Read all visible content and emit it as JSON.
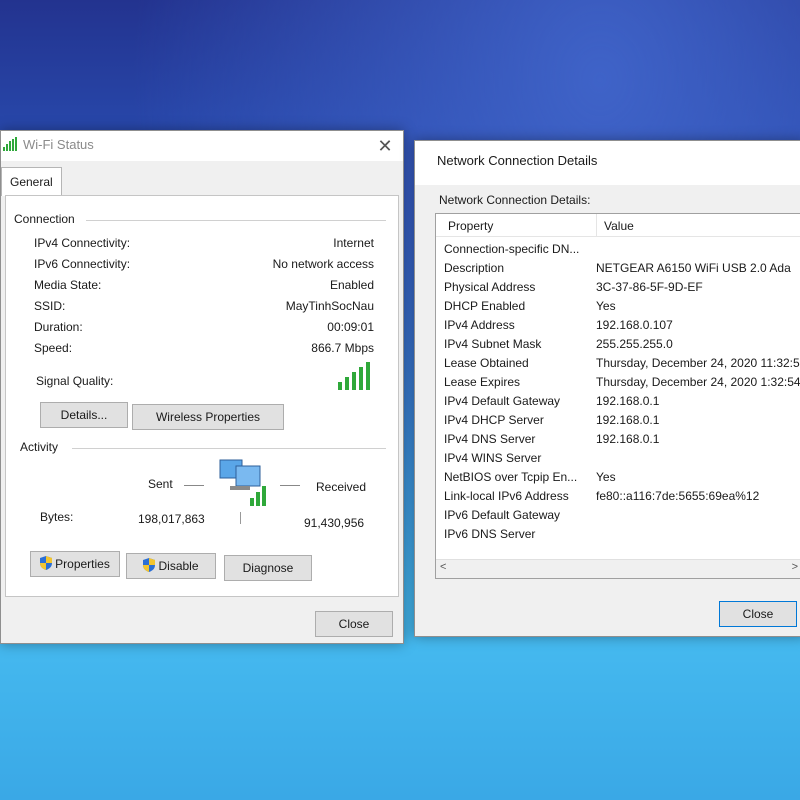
{
  "wifi_status": {
    "title": "Wi-Fi Status",
    "close_glyph": "✕",
    "tab_general": "General",
    "connection_group": "Connection",
    "rows": [
      {
        "key": "IPv4 Connectivity:",
        "value": "Internet"
      },
      {
        "key": "IPv6 Connectivity:",
        "value": "No network access"
      },
      {
        "key": "Media State:",
        "value": "Enabled"
      },
      {
        "key": "SSID:",
        "value": "MayTinhSocNau"
      },
      {
        "key": "Duration:",
        "value": "00:09:01"
      },
      {
        "key": "Speed:",
        "value": "866.7 Mbps"
      }
    ],
    "signal_quality_label": "Signal Quality:",
    "signal_level_bars": 5,
    "details_button": "Details...",
    "wireless_properties_button": "Wireless Properties",
    "activity_group": "Activity",
    "sent_label": "Sent",
    "received_label": "Received",
    "bytes_label": "Bytes:",
    "bytes_sent": "198,017,863",
    "bytes_received": "91,430,956",
    "properties_button": "Properties",
    "disable_button": "Disable",
    "diagnose_button": "Diagnose",
    "close_button": "Close",
    "icons": {
      "wifi": "wifi-signal-icon",
      "network": "network-computers-icon",
      "shield": "uac-shield-icon"
    },
    "colors": {
      "signal": "#2fa83a"
    }
  },
  "network_details": {
    "title": "Network Connection Details",
    "subtitle": "Network Connection Details:",
    "col_property": "Property",
    "col_value": "Value",
    "rows": [
      {
        "property": "Connection-specific DN...",
        "value": ""
      },
      {
        "property": "Description",
        "value": "NETGEAR A6150 WiFi USB 2.0 Ada"
      },
      {
        "property": "Physical Address",
        "value": "3C-37-86-5F-9D-EF"
      },
      {
        "property": "DHCP Enabled",
        "value": "Yes"
      },
      {
        "property": "IPv4 Address",
        "value": "192.168.0.107"
      },
      {
        "property": "IPv4 Subnet Mask",
        "value": "255.255.255.0"
      },
      {
        "property": "Lease Obtained",
        "value": "Thursday, December 24, 2020 11:32:5"
      },
      {
        "property": "Lease Expires",
        "value": "Thursday, December 24, 2020 1:32:54"
      },
      {
        "property": "IPv4 Default Gateway",
        "value": "192.168.0.1"
      },
      {
        "property": "IPv4 DHCP Server",
        "value": "192.168.0.1"
      },
      {
        "property": "IPv4 DNS Server",
        "value": "192.168.0.1"
      },
      {
        "property": "IPv4 WINS Server",
        "value": ""
      },
      {
        "property": "NetBIOS over Tcpip En...",
        "value": "Yes"
      },
      {
        "property": "Link-local IPv6 Address",
        "value": "fe80::a116:7de:5655:69ea%12"
      },
      {
        "property": "IPv6 Default Gateway",
        "value": ""
      },
      {
        "property": "IPv6 DNS Server",
        "value": ""
      }
    ],
    "scroll_left": "<",
    "scroll_right": ">",
    "close_button": "Close",
    "colors": {
      "focus_border": "#0078d7"
    }
  }
}
